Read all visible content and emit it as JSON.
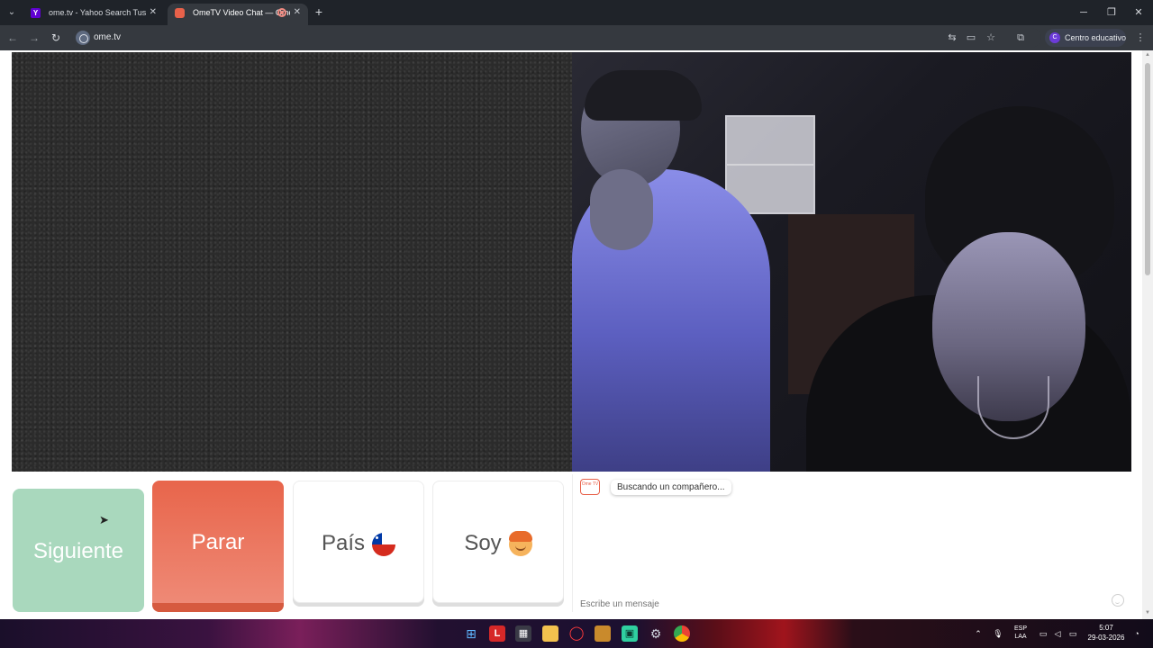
{
  "browser": {
    "tabs": [
      {
        "title": "ome.tv - Yahoo Search Tus resu",
        "favicon": "yahoo-icon",
        "active": false
      },
      {
        "title": "OmeTV Video Chat — Ome",
        "favicon": "ometv-icon",
        "active": true,
        "recording": true
      }
    ],
    "new_tab_symbol": "+",
    "window_controls": {
      "minimize": "─",
      "restore": "❐",
      "close": "✕"
    },
    "nav": {
      "back": "←",
      "forward": "→",
      "reload": "↻"
    },
    "url": "ome.tv",
    "profile_initial": "C",
    "profile_label": "Centro educativo"
  },
  "controls": {
    "next_label": "Siguiente",
    "stop_label": "Parar",
    "country_label": "País",
    "country_flag": "chile-flag-icon",
    "gender_label": "Soy",
    "gender_icon": "boy-icon",
    "colors": {
      "next": "#a9d8bd",
      "stop": "#e8654b",
      "text": "#555555"
    }
  },
  "chat": {
    "logo_text": "Ome TV",
    "status_message": "Buscando un compañero...",
    "input_placeholder": "Escribe un mensaje"
  },
  "taskbar": {
    "tray": {
      "lang_top": "ESP",
      "lang_bottom": "LAA"
    },
    "time": "5:07",
    "date": "29-03-2026"
  }
}
